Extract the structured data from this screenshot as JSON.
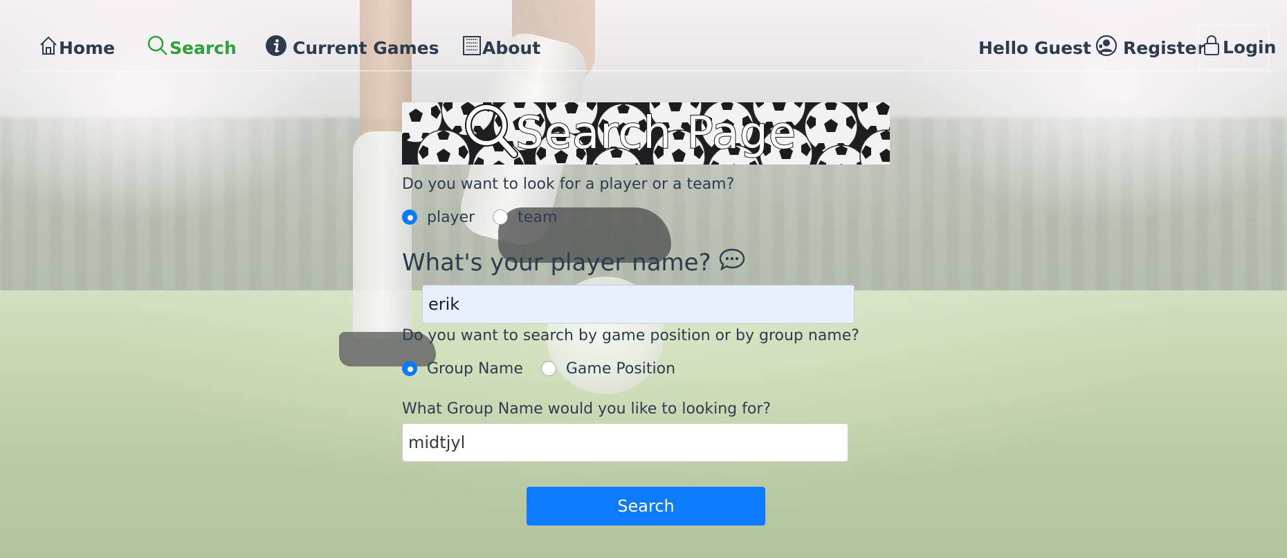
{
  "nav": {
    "home_label": "Home",
    "search_label": "Search",
    "current_games_label": "Current Games",
    "about_label": "About",
    "greeting": "Hello Guest :",
    "register_label": "Register",
    "login_label": "Login",
    "active_color": "#2ba23a",
    "text_color": "#2d3c4c"
  },
  "banner": {
    "title": "Search Page",
    "icon": "search-icon"
  },
  "form": {
    "type_question": "Do you want to look for a player or a team?",
    "type_options": [
      {
        "label": "player",
        "selected": true
      },
      {
        "label": "team",
        "selected": false
      }
    ],
    "name_heading": "What's your player name?",
    "name_value": "erik",
    "mode_question": "Do you want to search by game position or by group name?",
    "mode_options": [
      {
        "label": "Group Name",
        "selected": true
      },
      {
        "label": "Game Position",
        "selected": false
      }
    ],
    "group_question": "What Group Name would you like to looking for?",
    "group_value": "midtjyl",
    "submit_label": "Search",
    "accent_color": "#0d7bff"
  }
}
